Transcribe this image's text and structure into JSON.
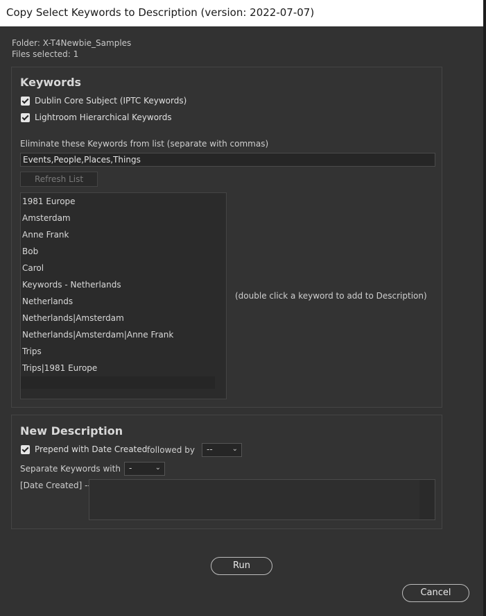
{
  "window": {
    "title": "Copy Select Keywords to Description (version: 2022-07-07)"
  },
  "info": {
    "folder": "Folder: X-T4Newbie_Samples",
    "files_selected": "Files selected: 1"
  },
  "keywords_panel": {
    "title": "Keywords",
    "checkbox_dublin": {
      "label": "Dublin Core Subject (IPTC Keywords)",
      "checked": true
    },
    "checkbox_lightroom": {
      "label": "Lightroom Hierarchical Keywords",
      "checked": true
    },
    "eliminate_label": "Eliminate these Keywords from list (separate with commas)",
    "eliminate_value": "Events,People,Places,Things",
    "refresh_label": "Refresh List",
    "items": [
      "1981 Europe",
      "Amsterdam",
      "Anne Frank",
      "Bob",
      "Carol",
      "Keywords - Netherlands",
      "Netherlands",
      "Netherlands|Amsterdam",
      "Netherlands|Amsterdam|Anne Frank",
      "Trips",
      "Trips|1981 Europe"
    ],
    "hint": "(double click a keyword to add to Description)"
  },
  "description_panel": {
    "title": "New Description",
    "prepend": {
      "label": "Prepend with Date Created",
      "checked": true
    },
    "followed_by_label": "followed by",
    "followed_by_value": "--",
    "separate_label": "Separate Keywords with",
    "separate_value": "-",
    "preview_label": "[Date Created] --",
    "preview_value": ""
  },
  "buttons": {
    "run": "Run",
    "cancel": "Cancel"
  },
  "icons": {
    "checkbox": "checkmark-icon",
    "dropdown": "chevron-down-icon"
  }
}
